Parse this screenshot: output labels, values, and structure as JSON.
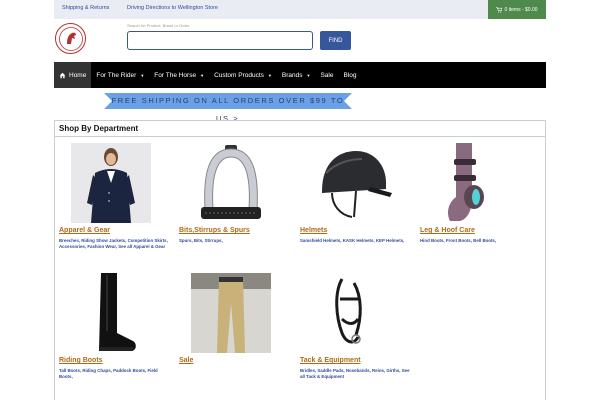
{
  "topbar": {
    "shipping_link": "Shipping & Returns",
    "directions_link": "Driving Directions to Wellington Store",
    "cart_icon": "shopping-cart-icon",
    "cart_text": "0 items - $0.00",
    "cart_bg": "#4f8a4c"
  },
  "header": {
    "logo_icon": "horse-head-logo",
    "search": {
      "label": "Search for Product, Brand or Order",
      "value": "",
      "placeholder": ""
    },
    "find_label": "FIND"
  },
  "nav": {
    "items": [
      {
        "label": "Home",
        "icon": "home-icon",
        "active": true
      },
      {
        "label": "For The Rider",
        "dropdown": true
      },
      {
        "label": "For The Horse",
        "dropdown": true
      },
      {
        "label": "Custom Products",
        "dropdown": true
      },
      {
        "label": "Brands",
        "dropdown": true
      },
      {
        "label": "Sale",
        "dropdown": false
      },
      {
        "label": "Blog",
        "dropdown": false
      }
    ]
  },
  "banner": {
    "line1": "FREE SHIPPING ON ALL ORDERS OVER $99 TO",
    "line2": "US >",
    "color": "#6aa0e6"
  },
  "departments": {
    "heading": "Shop By Department",
    "items": [
      {
        "title": "Apparel & Gear",
        "desc": "Breeches, Riding Show Jackets, Competition Skirts, Accessories, Fashion Wear, See all Apparel & Gear",
        "image": "riding-jacket-image"
      },
      {
        "title": "Bits,Stirrups & Spurs",
        "desc": "Spurs, Bits, Stirrups,",
        "image": "stirrup-image"
      },
      {
        "title": "Helmets",
        "desc": "Samshield Helmets, KASK Helmets, KEP Helmets,",
        "image": "helmet-image"
      },
      {
        "title": "Leg & Hoof Care",
        "desc": "Hind Boots, Front Boots, Bell Boots,",
        "image": "horse-boot-image"
      },
      {
        "title": "Riding Boots",
        "desc": "Tall Boots, Riding Chaps, Paddock Boots, Field Boots,",
        "image": "tall-boot-image"
      },
      {
        "title": "Sale",
        "desc": "",
        "image": "breeches-image"
      },
      {
        "title": "Tack & Equipment",
        "desc": "Bridles, Saddle Pads, Nosebands, Reins, Girths, See all Tack & Equipment",
        "image": "bridle-image"
      }
    ]
  }
}
